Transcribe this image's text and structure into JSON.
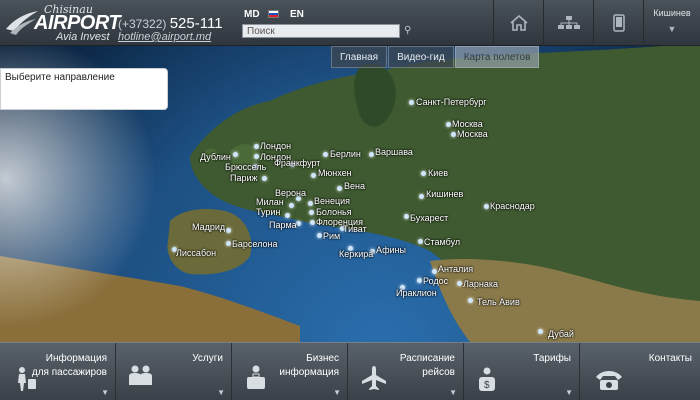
{
  "header": {
    "logo": {
      "city": "Chisinau",
      "name": "AIRPORT",
      "subtitle": "Avia Invest"
    },
    "phone_prefix": "(+37322)",
    "phone_number": "525-111",
    "email": "hotline@airport.md",
    "lang_md": "MD",
    "lang_en": "EN",
    "search_placeholder": "Поиск",
    "icons": {
      "home": "home-icon",
      "sitemap": "sitemap-icon",
      "mobile": "mobile-icon"
    },
    "city_select": "Кишинев"
  },
  "map": {
    "tabs": [
      "Главная",
      "Видео-гид",
      "Карта полетов"
    ],
    "active_tab": "Карта полетов",
    "direction_placeholder": "Выберите направление",
    "cities": [
      "Санкт-Петербург",
      "Москва",
      "Москва",
      "Лондон",
      "Дублин",
      "Лондон",
      "Берлин",
      "Варшава",
      "Брюссель",
      "Франкфурт",
      "Париж",
      "Мюнхен",
      "Киев",
      "Вена",
      "Верона",
      "Кишинев",
      "Милан",
      "Венеция",
      "Краснодар",
      "Турин",
      "Болонья",
      "Бухарест",
      "Парма",
      "Флоренция",
      "Мадрид",
      "Тиват",
      "Рим",
      "Стамбул",
      "Барселона",
      "Афины",
      "Лиссабон",
      "Керкира",
      "Анталия",
      "Родос",
      "Ларнака",
      "Ираклион",
      "Тель Авив",
      "Дубай"
    ]
  },
  "bottom_nav": [
    {
      "label_1": "Информация",
      "label_2": "для пассажиров",
      "icon": "passenger-icon"
    },
    {
      "label_1": "Услуги",
      "label_2": "",
      "icon": "services-icon"
    },
    {
      "label_1": "Бизнес",
      "label_2": "информация",
      "icon": "briefcase-icon"
    },
    {
      "label_1": "Расписание",
      "label_2": "рейсов",
      "icon": "plane-icon"
    },
    {
      "label_1": "Тарифы",
      "label_2": "",
      "icon": "tariff-icon"
    },
    {
      "label_1": "Контакты",
      "label_2": "",
      "icon": "phone-icon"
    }
  ],
  "colors": {
    "header": "#3a4148",
    "map_sea": "#1d4f82",
    "land": "#3d5a2e",
    "accent": "#ffffff"
  }
}
